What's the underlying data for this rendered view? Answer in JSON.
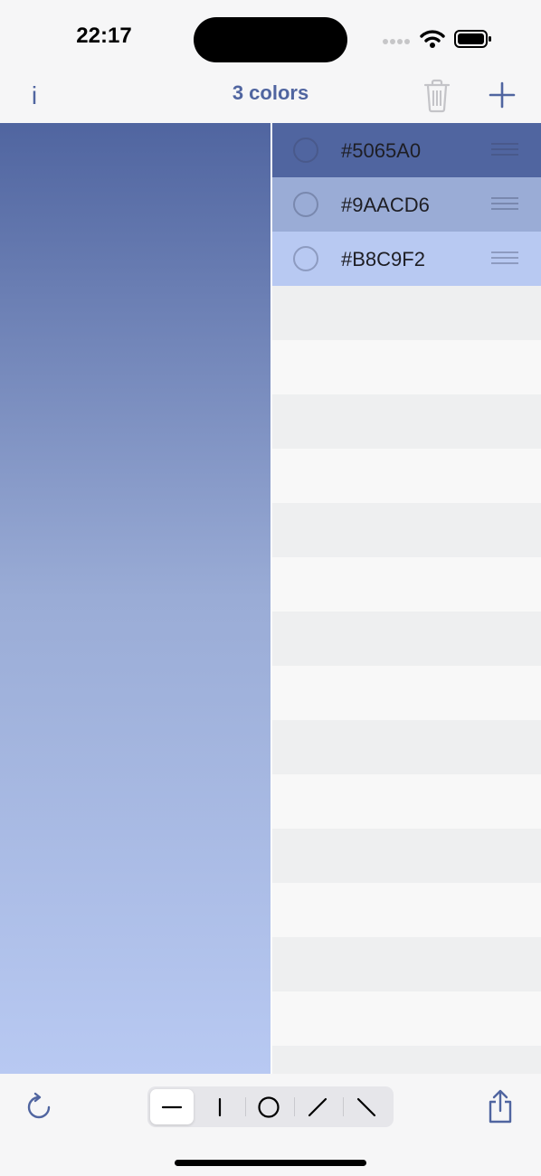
{
  "status_bar": {
    "time": "22:17"
  },
  "nav": {
    "info_label": "i",
    "title": "3 colors",
    "trash_icon": "trash-icon",
    "add_icon": "plus-icon"
  },
  "gradient": {
    "direction": "top-to-bottom",
    "stops": [
      "#5065A0",
      "#9AACD6",
      "#B8C9F2"
    ]
  },
  "colors": [
    {
      "hex": "#5065A0",
      "fill": "#5065a0",
      "selected": false
    },
    {
      "hex": "#9AACD6",
      "fill": "#9aacd6",
      "selected": false
    },
    {
      "hex": "#B8C9F2",
      "fill": "#b8c9f2",
      "selected": false
    }
  ],
  "toolbar": {
    "reset_icon": "rotate-icon",
    "share_icon": "share-icon",
    "gradient_types": [
      {
        "name": "horizontal-line",
        "selected": true
      },
      {
        "name": "vertical-line",
        "selected": false
      },
      {
        "name": "circle",
        "selected": false
      },
      {
        "name": "diagonal-up",
        "selected": false
      },
      {
        "name": "diagonal-down",
        "selected": false
      }
    ]
  },
  "theme": {
    "accent": "#5065a0"
  }
}
